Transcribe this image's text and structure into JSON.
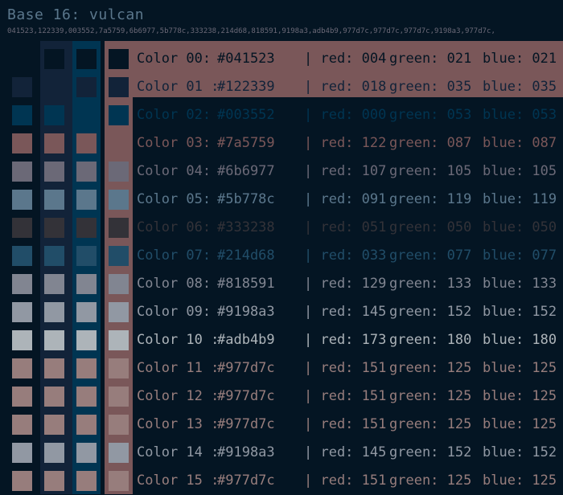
{
  "title": "Base 16: vulcan",
  "hex_list": "041523,122339,003552,7a5759,6b6977,5b778c,333238,214d68,818591,9198a3,adb4b9,977d7c,977d7c,977d7c,9198a3,977d7c,",
  "background": "#041523",
  "column_backgrounds": [
    "#041523",
    "#122339",
    "#003552",
    "#7a5759"
  ],
  "colors": [
    {
      "label": "Color 00:",
      "hex": "#041523",
      "red": "| red: 004",
      "green": "green: 021",
      "blue": "blue: 021",
      "text_color": "#041523"
    },
    {
      "label": "Color 01 :",
      "hex": "#122339",
      "red": "| red: 018",
      "green": "green: 035",
      "blue": "blue: 035",
      "text_color": "#122339"
    },
    {
      "label": "Color 02:",
      "hex": "#003552",
      "red": "| red: 000",
      "green": "green: 053",
      "blue": "blue: 053",
      "text_color": "#003552"
    },
    {
      "label": "Color 03:",
      "hex": "#7a5759",
      "red": "| red: 122",
      "green": "green: 087",
      "blue": "blue: 087",
      "text_color": "#7a5759"
    },
    {
      "label": "Color 04:",
      "hex": "#6b6977",
      "red": "| red: 107",
      "green": "green: 105",
      "blue": "blue: 105",
      "text_color": "#6b6977"
    },
    {
      "label": "Color 05:",
      "hex": "#5b778c",
      "red": "| red: 091",
      "green": "green: 119",
      "blue": "blue: 119",
      "text_color": "#5b778c"
    },
    {
      "label": "Color 06:",
      "hex": "#333238",
      "red": "| red: 051",
      "green": "green: 050",
      "blue": "blue: 050",
      "text_color": "#333238"
    },
    {
      "label": "Color 07:",
      "hex": "#214d68",
      "red": "| red: 033",
      "green": "green: 077",
      "blue": "blue: 077",
      "text_color": "#214d68"
    },
    {
      "label": "Color 08:",
      "hex": "#818591",
      "red": "| red: 129",
      "green": "green: 133",
      "blue": "blue: 133",
      "text_color": "#818591"
    },
    {
      "label": "Color 09:",
      "hex": "#9198a3",
      "red": "| red: 145",
      "green": "green: 152",
      "blue": "blue: 152",
      "text_color": "#9198a3"
    },
    {
      "label": "Color 10 :",
      "hex": "#adb4b9",
      "red": "| red: 173",
      "green": "green: 180",
      "blue": "blue: 180",
      "text_color": "#adb4b9"
    },
    {
      "label": "Color 11 :",
      "hex": "#977d7c",
      "red": "| red: 151",
      "green": "green: 125",
      "blue": "blue: 125",
      "text_color": "#977d7c"
    },
    {
      "label": "Color 12 :",
      "hex": "#977d7c",
      "red": "| red: 151",
      "green": "green: 125",
      "blue": "blue: 125",
      "text_color": "#977d7c"
    },
    {
      "label": "Color 13 :",
      "hex": "#977d7c",
      "red": "| red: 151",
      "green": "green: 125",
      "blue": "blue: 125",
      "text_color": "#977d7c"
    },
    {
      "label": "Color 14 :",
      "hex": "#9198a3",
      "red": "| red: 145",
      "green": "green: 152",
      "blue": "blue: 152",
      "text_color": "#9198a3"
    },
    {
      "label": "Color 15 :",
      "hex": "#977d7c",
      "red": "| red: 151",
      "green": "green: 125",
      "blue": "blue: 125",
      "text_color": "#977d7c"
    }
  ]
}
